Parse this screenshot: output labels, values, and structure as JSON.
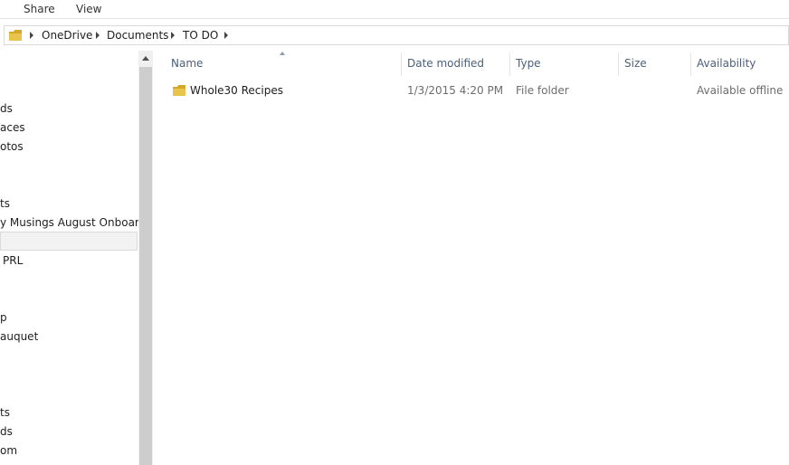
{
  "ribbon": {
    "tabs": [
      "Share",
      "View"
    ]
  },
  "address": {
    "crumbs": [
      "OneDrive",
      "Documents",
      "TO DO"
    ]
  },
  "nav": {
    "items": [
      "ds",
      "aces",
      "otos",
      "ts",
      "y Musings August Onboardin",
      "PRL",
      "p",
      "auquet",
      "ts",
      "ds",
      "om"
    ]
  },
  "columns": {
    "name": "Name",
    "date": "Date modified",
    "type": "Type",
    "size": "Size",
    "availability": "Availability"
  },
  "files": [
    {
      "name": "Whole30 Recipes",
      "date": "1/3/2015 4:20 PM",
      "type": "File folder",
      "size": "",
      "availability": "Available offline"
    }
  ],
  "colors": {
    "folder": "#e8c44c",
    "folder_dark": "#d4a92a",
    "header_text": "#4c607a",
    "secondary_text": "#6d6d6d"
  }
}
